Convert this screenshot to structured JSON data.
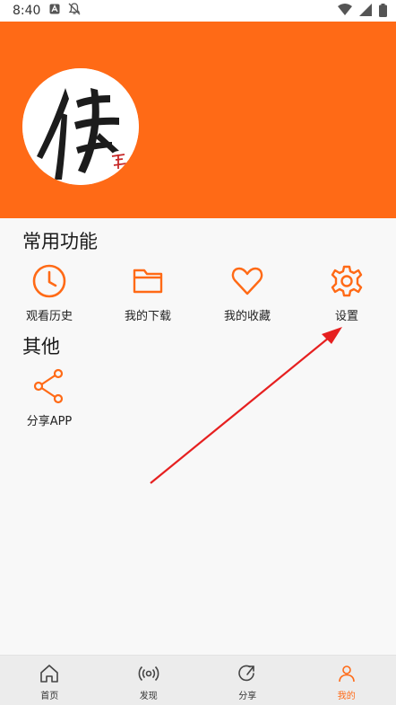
{
  "status_bar": {
    "time": "8:40"
  },
  "colors": {
    "accent": "#ff6a16",
    "annotation_arrow": "#e62020"
  },
  "sections": {
    "common": {
      "title": "常用功能",
      "items": [
        {
          "label": "观看历史",
          "icon": "clock-icon"
        },
        {
          "label": "我的下载",
          "icon": "folder-icon"
        },
        {
          "label": "我的收藏",
          "icon": "heart-icon"
        },
        {
          "label": "设置",
          "icon": "gear-icon"
        }
      ]
    },
    "other": {
      "title": "其他",
      "items": [
        {
          "label": "分享APP",
          "icon": "share-icon"
        }
      ]
    }
  },
  "bottom_nav": {
    "items": [
      {
        "label": "首页",
        "icon": "home-icon",
        "active": false
      },
      {
        "label": "发现",
        "icon": "broadcast-icon",
        "active": false
      },
      {
        "label": "分享",
        "icon": "share-arrow-icon",
        "active": false
      },
      {
        "label": "我的",
        "icon": "person-icon",
        "active": true
      }
    ]
  }
}
